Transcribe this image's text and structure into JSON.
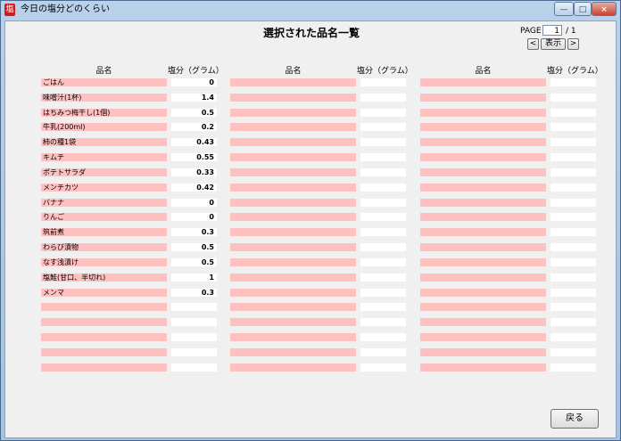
{
  "window": {
    "title": "今日の塩分どのくらい",
    "icon": "app-icon",
    "minimize": "—",
    "maximize": "□",
    "close": "×"
  },
  "header": {
    "title": "選択された品名一覧",
    "page_label": "PAGE",
    "page_value": "1",
    "page_total": "/ 1",
    "prev_label": "<",
    "show_label": "表示",
    "next_label": ">"
  },
  "columns": [
    {
      "name_header": "品名",
      "value_header": "塩分（グラム）",
      "rows": [
        {
          "name": "ごはん",
          "value": "0"
        },
        {
          "name": "味噌汁(1杯)",
          "value": "1.4"
        },
        {
          "name": "はちみつ梅干し(1個)",
          "value": "0.5"
        },
        {
          "name": "牛乳(200ml)",
          "value": "0.2"
        },
        {
          "name": "柿の種1袋",
          "value": "0.43"
        },
        {
          "name": "キムチ",
          "value": "0.55"
        },
        {
          "name": "ポテトサラダ",
          "value": "0.33"
        },
        {
          "name": "メンチカツ",
          "value": "0.42"
        },
        {
          "name": "バナナ",
          "value": "0"
        },
        {
          "name": "りんご",
          "value": "0"
        },
        {
          "name": "筑前煮",
          "value": "0.3"
        },
        {
          "name": "わらび漬物",
          "value": "0.5"
        },
        {
          "name": "なす浅漬け",
          "value": "0.5"
        },
        {
          "name": "塩鮭(甘口、半切れ)",
          "value": "1"
        },
        {
          "name": "メンマ",
          "value": "0.3"
        },
        {
          "name": "",
          "value": ""
        },
        {
          "name": "",
          "value": ""
        },
        {
          "name": "",
          "value": ""
        },
        {
          "name": "",
          "value": ""
        },
        {
          "name": "",
          "value": ""
        }
      ]
    },
    {
      "name_header": "品名",
      "value_header": "塩分（グラム）",
      "rows": [
        {
          "name": "",
          "value": ""
        },
        {
          "name": "",
          "value": ""
        },
        {
          "name": "",
          "value": ""
        },
        {
          "name": "",
          "value": ""
        },
        {
          "name": "",
          "value": ""
        },
        {
          "name": "",
          "value": ""
        },
        {
          "name": "",
          "value": ""
        },
        {
          "name": "",
          "value": ""
        },
        {
          "name": "",
          "value": ""
        },
        {
          "name": "",
          "value": ""
        },
        {
          "name": "",
          "value": ""
        },
        {
          "name": "",
          "value": ""
        },
        {
          "name": "",
          "value": ""
        },
        {
          "name": "",
          "value": ""
        },
        {
          "name": "",
          "value": ""
        },
        {
          "name": "",
          "value": ""
        },
        {
          "name": "",
          "value": ""
        },
        {
          "name": "",
          "value": ""
        },
        {
          "name": "",
          "value": ""
        },
        {
          "name": "",
          "value": ""
        }
      ]
    },
    {
      "name_header": "品名",
      "value_header": "塩分（グラム）",
      "rows": [
        {
          "name": "",
          "value": ""
        },
        {
          "name": "",
          "value": ""
        },
        {
          "name": "",
          "value": ""
        },
        {
          "name": "",
          "value": ""
        },
        {
          "name": "",
          "value": ""
        },
        {
          "name": "",
          "value": ""
        },
        {
          "name": "",
          "value": ""
        },
        {
          "name": "",
          "value": ""
        },
        {
          "name": "",
          "value": ""
        },
        {
          "name": "",
          "value": ""
        },
        {
          "name": "",
          "value": ""
        },
        {
          "name": "",
          "value": ""
        },
        {
          "name": "",
          "value": ""
        },
        {
          "name": "",
          "value": ""
        },
        {
          "name": "",
          "value": ""
        },
        {
          "name": "",
          "value": ""
        },
        {
          "name": "",
          "value": ""
        },
        {
          "name": "",
          "value": ""
        },
        {
          "name": "",
          "value": ""
        },
        {
          "name": "",
          "value": ""
        }
      ]
    }
  ],
  "footer": {
    "back_label": "戻る"
  },
  "colors": {
    "name_cell": "#ffc0c0",
    "value_cell": "#ffffff",
    "background": "#f0f0f0"
  }
}
